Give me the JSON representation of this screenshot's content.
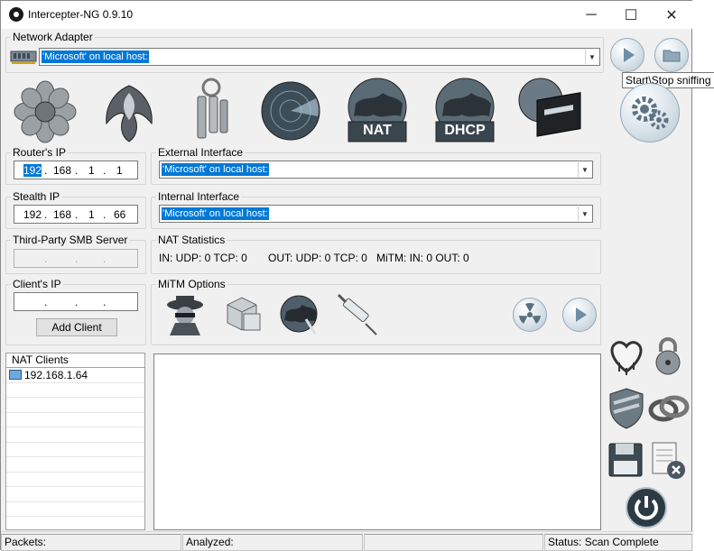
{
  "window": {
    "title": "Intercepter-NG 0.9.10",
    "controls": {
      "minimize": "─",
      "maximize": "☐",
      "close": "✕"
    }
  },
  "network_adapter": {
    "legend": "Network Adapter",
    "selected": "'Microsoft' on local host:"
  },
  "toolbar_icons": [
    "flower-icon",
    "phoenix-icon",
    "keys-icon",
    "radar-icon",
    "nat-globe-icon",
    "dhcp-globe-icon",
    "router-icon"
  ],
  "toolbar_labels": {
    "nat": "NAT",
    "dhcp": "DHCP"
  },
  "router_ip": {
    "legend": "Router's IP",
    "octets": [
      "192",
      "168",
      "1",
      "1"
    ]
  },
  "stealth_ip": {
    "legend": "Stealth IP",
    "octets": [
      "192",
      "168",
      "1",
      "66"
    ]
  },
  "smb_server": {
    "legend": "Third-Party SMB Server"
  },
  "client_ip": {
    "legend": "Client's IP",
    "add_button": "Add Client"
  },
  "external_interface": {
    "legend": "External Interface",
    "selected": "'Microsoft' on local host:"
  },
  "internal_interface": {
    "legend": "Internal Interface",
    "selected": "'Microsoft' on local host:"
  },
  "nat_statistics": {
    "legend": "NAT Statistics",
    "in": "IN: UDP: 0 TCP: 0",
    "out": "OUT: UDP: 0 TCP: 0",
    "mitm": "MiTM: IN: 0 OUT: 0"
  },
  "mitm_options": {
    "legend": "MiTM Options"
  },
  "nat_clients": {
    "header": "NAT Clients",
    "items": [
      "192.168.1.64"
    ]
  },
  "tooltip": "Start\\Stop sniffing",
  "status_bar": {
    "packets": "Packets:",
    "analyzed": "Analyzed:",
    "status": "Status: Scan Complete"
  }
}
